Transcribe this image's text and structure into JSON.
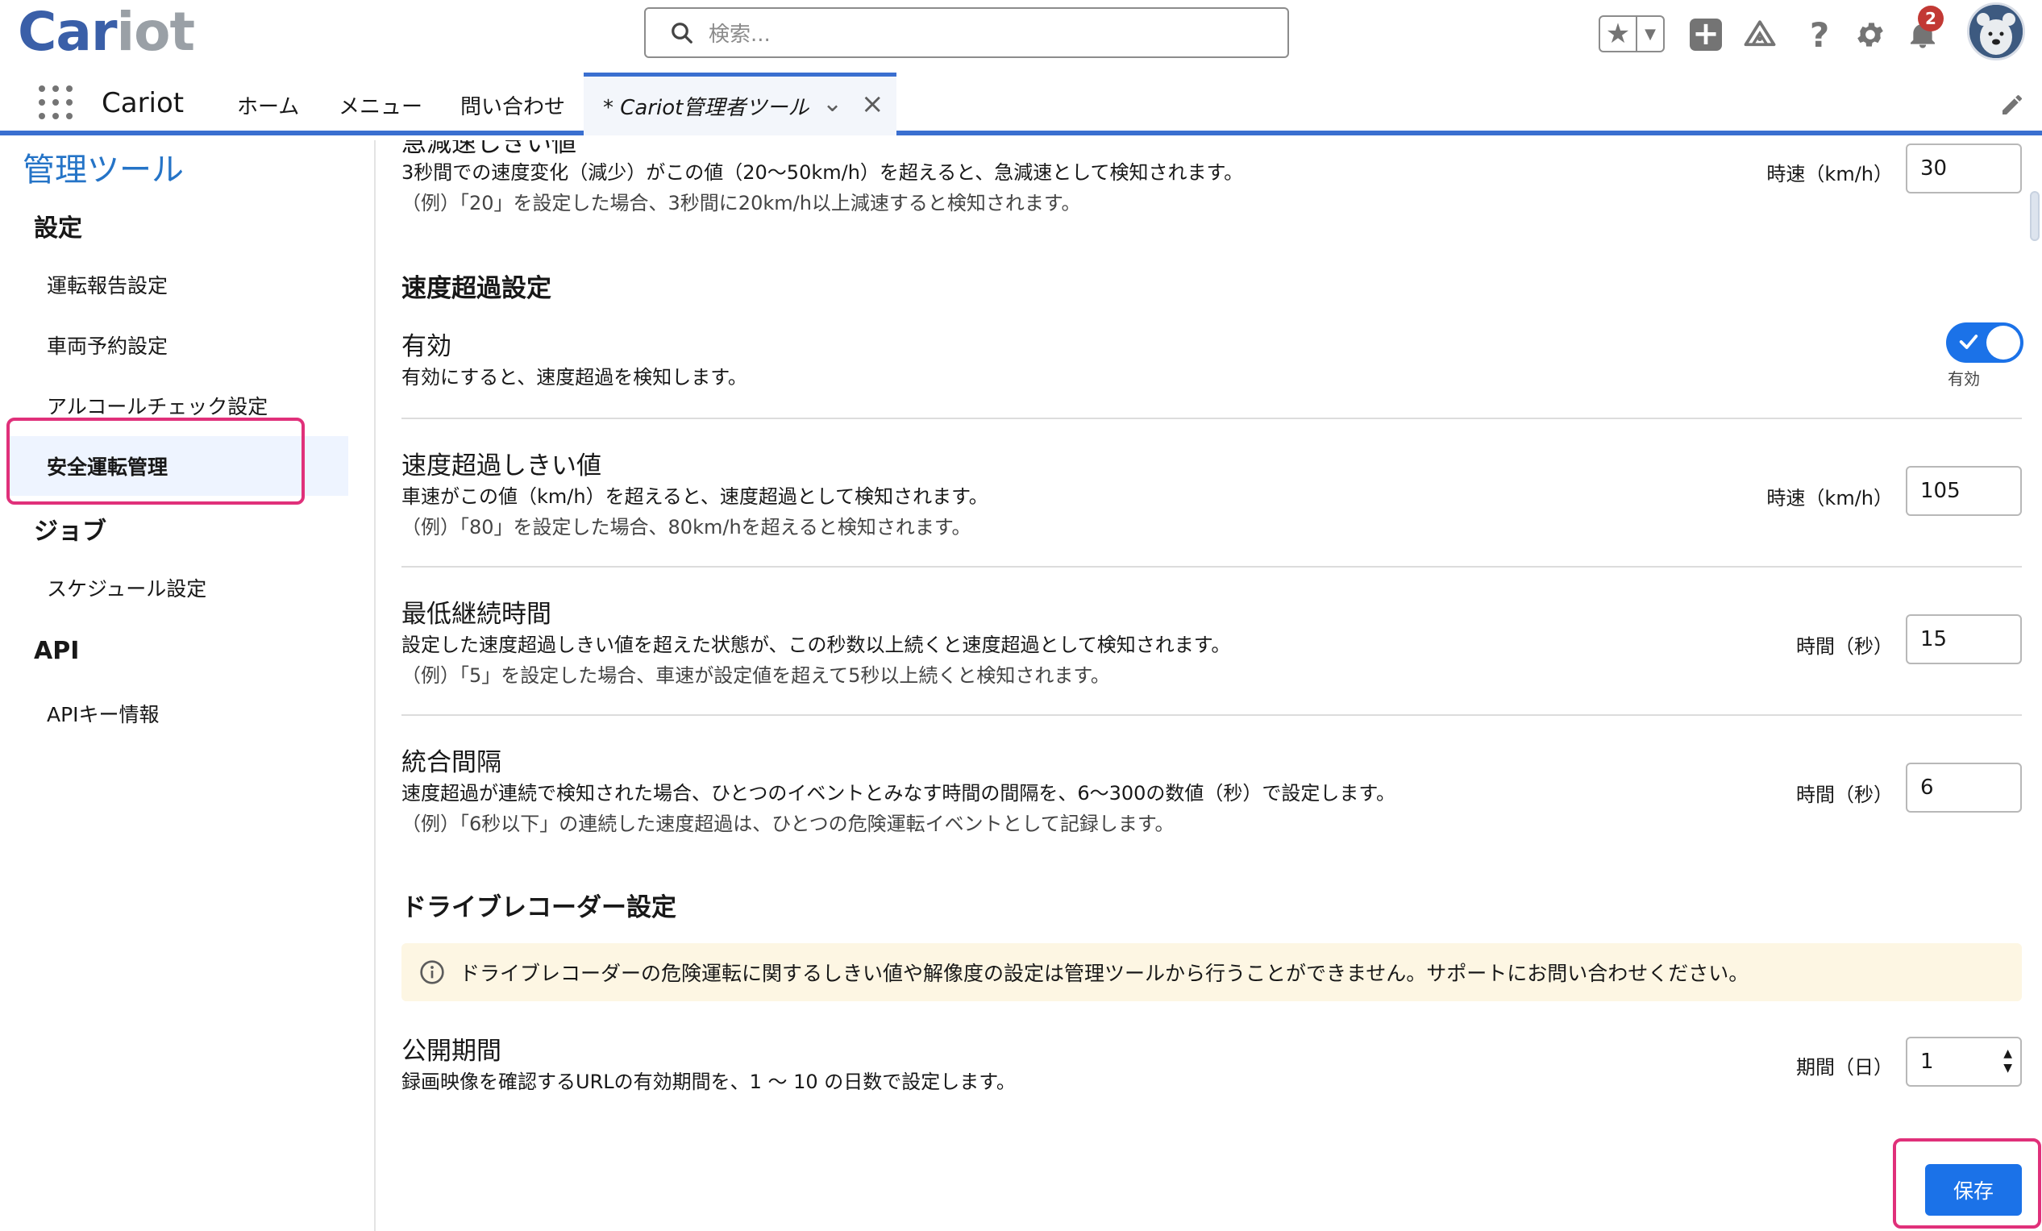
{
  "header": {
    "logo_part1": "Car",
    "logo_part2": "iot",
    "search_placeholder": "検索...",
    "notification_count": "2"
  },
  "nav": {
    "app_name": "Cariot",
    "tabs": [
      {
        "label": "ホーム"
      },
      {
        "label": "メニュー"
      },
      {
        "label": "問い合わせ"
      }
    ],
    "active_tab": "* Cariot管理者ツール"
  },
  "sidebar": {
    "title": "管理ツール",
    "sections": [
      {
        "label": "設定",
        "items": [
          "運転報告設定",
          "車両予約設定",
          "アルコールチェック設定",
          "安全運転管理"
        ]
      },
      {
        "label": "ジョブ",
        "items": [
          "スケジュール設定"
        ]
      },
      {
        "label": "API",
        "items": [
          "APIキー情報"
        ]
      }
    ],
    "active_item": "安全運転管理"
  },
  "main": {
    "partial_title": "急減速しきい値",
    "decel": {
      "desc1": "3秒間での速度変化（減少）がこの値（20〜50km/h）を超えると、急減速として検知されます。",
      "desc2": "（例）「20」を設定した場合、3秒間に20km/h以上減速すると検知されます。",
      "unit": "時速（km/h）",
      "value": "30"
    },
    "speeding_section": "速度超過設定",
    "enabled": {
      "title": "有効",
      "desc": "有効にすると、速度超過を検知します。",
      "toggle_label": "有効",
      "on": true
    },
    "threshold": {
      "title": "速度超過しきい値",
      "desc1": "車速がこの値（km/h）を超えると、速度超過として検知されます。",
      "desc2": "（例）「80」を設定した場合、80km/hを超えると検知されます。",
      "unit": "時速（km/h）",
      "value": "105"
    },
    "min_duration": {
      "title": "最低継続時間",
      "desc1": "設定した速度超過しきい値を超えた状態が、この秒数以上続くと速度超過として検知されます。",
      "desc2": "（例）「5」を設定した場合、車速が設定値を超えて5秒以上続くと検知されます。",
      "unit": "時間（秒）",
      "value": "15"
    },
    "merge_interval": {
      "title": "統合間隔",
      "desc1": "速度超過が連続で検知された場合、ひとつのイベントとみなす時間の間隔を、6〜300の数値（秒）で設定します。",
      "desc2": "（例）「6秒以下」の連続した速度超過は、ひとつの危険運転イベントとして記録します。",
      "unit": "時間（秒）",
      "value": "6"
    },
    "recorder_section": "ドライブレコーダー設定",
    "notice": "ドライブレコーダーの危険運転に関するしきい値や解像度の設定は管理ツールから行うことができません。サポートにお問い合わせください。",
    "publish_period": {
      "title": "公開期間",
      "desc": "録画映像を確認するURLの有効期間を、1 〜 10 の日数で設定します。",
      "unit": "期間（日）",
      "value": "1"
    },
    "save_label": "保存"
  },
  "colors": {
    "brand_blue": "#1b72e8",
    "highlight_pink": "#e0307a",
    "sidebar_title": "#2574c7"
  }
}
